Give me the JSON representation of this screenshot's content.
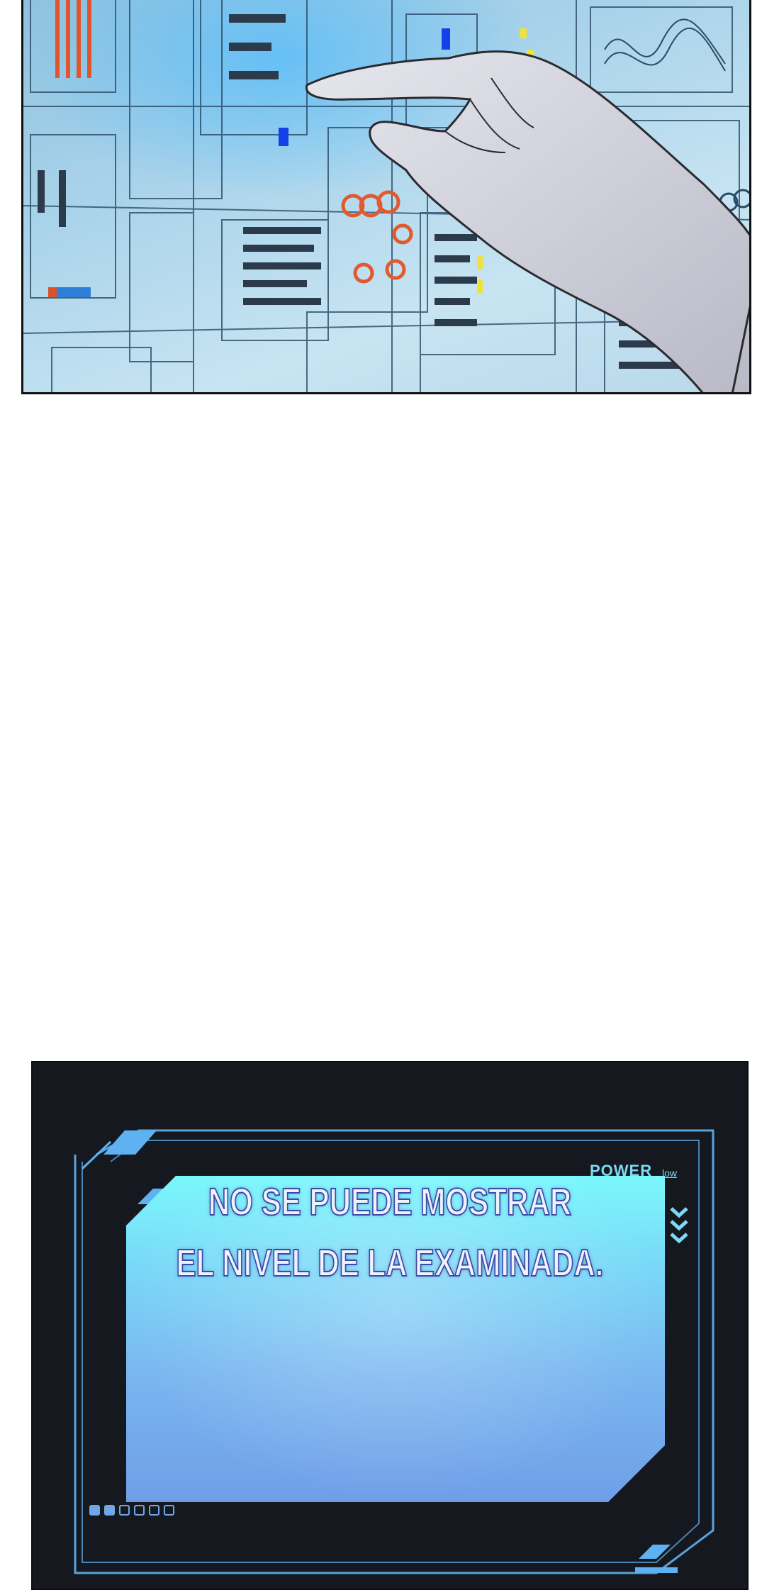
{
  "system_window": {
    "power_label": "POWER",
    "power_level": "low",
    "message_line_1": "NO SE PUEDE MOSTRAR",
    "message_line_2": "EL NIVEL DE LA EXAMINADA.",
    "page_indicator": {
      "total": 6,
      "active": 2
    }
  },
  "colors": {
    "window_background": "#15191f",
    "frame_line": "#5fb2f2",
    "screen_top": "#7af7fb",
    "screen_bottom": "#6f9ee8",
    "text_outline": "#3b4aa8"
  },
  "icons": {
    "scroll_indicator": "chevrons-down-icon"
  }
}
